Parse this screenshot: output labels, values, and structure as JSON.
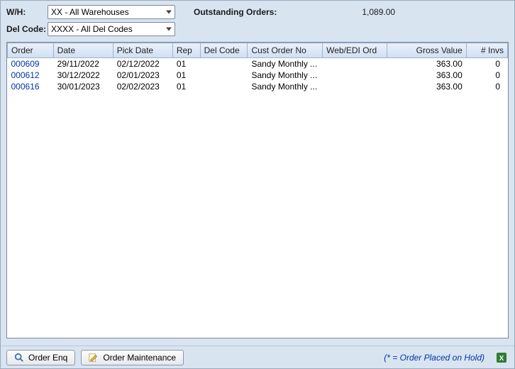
{
  "filters": {
    "wh_label": "W/H:",
    "wh_value": "XX - All Warehouses",
    "delcode_label": "Del Code:",
    "delcode_value": "XXXX - All Del Codes"
  },
  "outstanding": {
    "label": "Outstanding Orders:",
    "value": "1,089.00"
  },
  "grid": {
    "columns": [
      "Order",
      "Date",
      "Pick Date",
      "Rep",
      "Del Code",
      "Cust Order No",
      "Web/EDI Ord",
      "Gross Value",
      "# Invs"
    ],
    "rows": [
      {
        "order": "000609",
        "date": "29/11/2022",
        "pick": "02/12/2022",
        "rep": "01",
        "delcode": "",
        "custord": "Sandy Monthly ...",
        "web": "",
        "gross": "363.00",
        "invs": "0"
      },
      {
        "order": "000612",
        "date": "30/12/2022",
        "pick": "02/01/2023",
        "rep": "01",
        "delcode": "",
        "custord": "Sandy Monthly ...",
        "web": "",
        "gross": "363.00",
        "invs": "0"
      },
      {
        "order": "000616",
        "date": "30/01/2023",
        "pick": "02/02/2023",
        "rep": "01",
        "delcode": "",
        "custord": "Sandy Monthly ...",
        "web": "",
        "gross": "363.00",
        "invs": "0"
      }
    ]
  },
  "footer": {
    "order_enq": "Order Enq",
    "order_maint": "Order Maintenance",
    "legend": "(* = Order Placed on Hold)"
  },
  "icons": {
    "magnifier": "search-icon",
    "pencil": "edit-icon",
    "excel": "excel-export-icon"
  }
}
